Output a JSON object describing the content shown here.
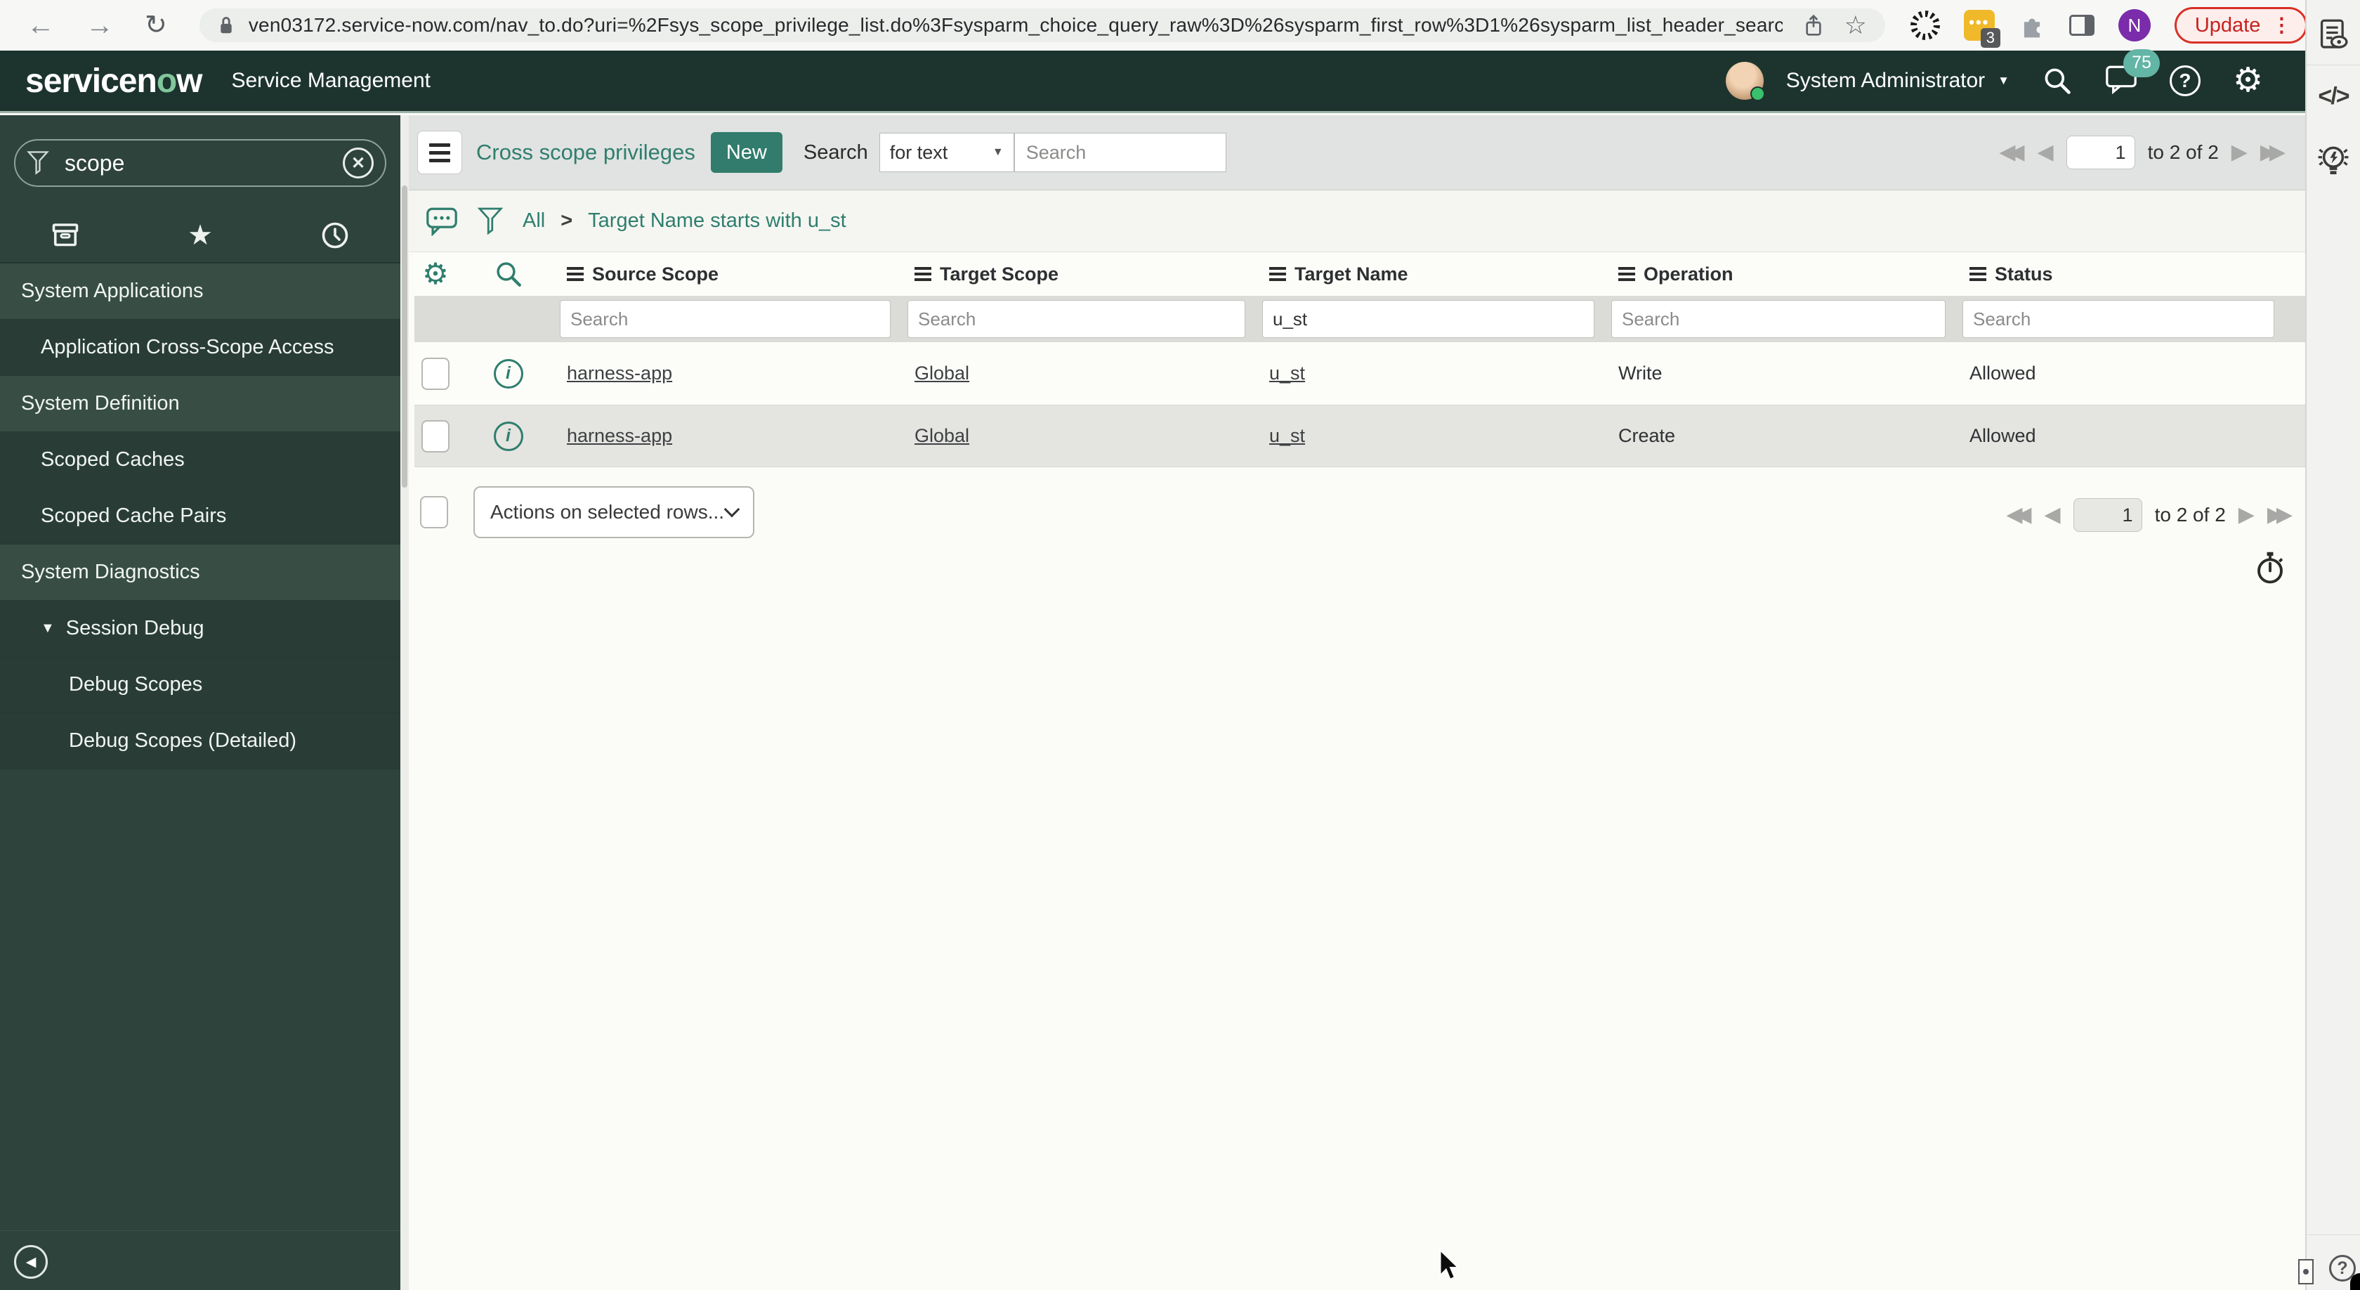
{
  "browser": {
    "url": "ven03172.service-now.com/nav_to.do?uri=%2Fsys_scope_privilege_list.do%3Fsysparm_choice_query_raw%3D%26sysparm_first_row%3D1%26sysparm_list_header_searc...",
    "extension_badge": "3",
    "avatar_letter": "N",
    "update_label": "Update"
  },
  "header": {
    "logo_prefix": "servicen",
    "logo_o": "o",
    "logo_suffix": "w",
    "product": "Service Management",
    "user": "System Administrator",
    "notification_count": "75"
  },
  "sidebar": {
    "search_value": "scope",
    "items": [
      {
        "label": "System Applications"
      },
      {
        "label": "Application Cross-Scope Access"
      },
      {
        "label": "System Definition"
      },
      {
        "label": "Scoped Caches"
      },
      {
        "label": "Scoped Cache Pairs"
      },
      {
        "label": "System Diagnostics"
      },
      {
        "label": "Session Debug"
      },
      {
        "label": "Debug Scopes"
      },
      {
        "label": "Debug Scopes (Detailed)"
      }
    ]
  },
  "toolbar": {
    "title": "Cross scope privileges",
    "new_label": "New",
    "search_label": "Search",
    "search_type": "for text",
    "search_placeholder": "Search"
  },
  "breadcrumb": {
    "all": "All",
    "separator": ">",
    "filter": "Target Name starts with u_st"
  },
  "pagination": {
    "page": "1",
    "range_label": "to 2 of 2"
  },
  "table": {
    "columns": [
      {
        "label": "Source Scope"
      },
      {
        "label": "Target Scope"
      },
      {
        "label": "Target Name"
      },
      {
        "label": "Operation"
      },
      {
        "label": "Status"
      }
    ],
    "search_placeholder": "Search",
    "target_name_search": "u_st",
    "rows": [
      {
        "source_scope": "harness-app",
        "target_scope": "Global",
        "target_name": "u_st",
        "operation": "Write",
        "status": "Allowed"
      },
      {
        "source_scope": "harness-app",
        "target_scope": "Global",
        "target_name": "u_st",
        "operation": "Create",
        "status": "Allowed"
      }
    ],
    "actions_label": "Actions on selected rows..."
  },
  "colors": {
    "accent_teal": "#2f7e6d",
    "header_green": "#1d342e",
    "sidebar_green": "#2e433c",
    "badge_teal": "#63b5a5",
    "update_red": "#c5221f",
    "new_button_green": "#317c6c"
  }
}
